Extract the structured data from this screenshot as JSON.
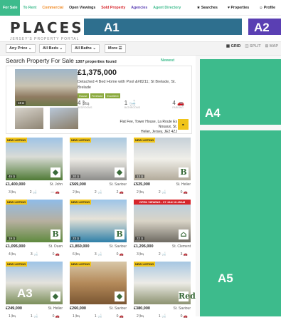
{
  "nav": {
    "items": [
      "For Sale",
      "To Rent",
      "Commercial",
      "Open Viewings",
      "Sold Property",
      "Agencies",
      "Agent Directory"
    ],
    "right": [
      "★ Searches",
      "♥ Properties",
      "☺ Profile"
    ]
  },
  "logo": {
    "title": "PLACES",
    "subtitle": "JERSEY'S PROPERTY PORTAL"
  },
  "ads": {
    "a1": "A1",
    "a2": "A2",
    "a3": "A3",
    "a4": "A4",
    "a5": "A5"
  },
  "filters": {
    "price": "Any Price ⌄",
    "beds": "All Beds ⌄",
    "baths": "All Baths ⌄",
    "more": "More ☰"
  },
  "views": {
    "grid": "▦ GRID",
    "split": "◫ SPLIT",
    "map": "⊞ MAP"
  },
  "heading": {
    "title": "Search Property For Sale",
    "count": "1307 properties found",
    "sort": "Newest"
  },
  "featured": {
    "price": "£1,375,000",
    "description": "Detached 4 Bed Home with Pool &#8211; St Brelade, St. Brelade",
    "tags": [
      "House",
      "Freehold",
      "Excellent"
    ],
    "beds": "4 🛏",
    "baths": "1 🛁",
    "parking": "4 🚗",
    "bed_label": "BEDROOMS",
    "bath_label": "BATHROOMS",
    "park_label": "PARKING",
    "img_count": "18 ◘",
    "agent_line1": "Flat Fee, Tower House, La Route Es Nouaux, St.",
    "agent_line2": "Helier, Jersey, JE2 4ZJ",
    "agent_logo": "■"
  },
  "cards": [
    {
      "price": "£1,400,000",
      "loc": "St. John",
      "beds": "3 🛏",
      "baths": "2 🛁",
      "park": "— 🚗",
      "badge": "NEW LISTING",
      "count": "45 ◘",
      "agent": "◆"
    },
    {
      "price": "£569,000",
      "loc": "St. Saviour",
      "beds": "2 🛏",
      "baths": "2 🛁",
      "park": "2 🚗",
      "badge": "NEW LISTING",
      "count": "20 ◘",
      "agent": "◆"
    },
    {
      "price": "£525,000",
      "loc": "St. Helier",
      "beds": "2 🛏",
      "baths": "2 🛁",
      "park": "0 🚗",
      "badge": "NEW LISTING",
      "count": "13 ◘",
      "agent": "B"
    },
    {
      "price": "£1,095,000",
      "loc": "St. Ouen",
      "beds": "4 🛏",
      "baths": "3 🛁",
      "park": "0 🚗",
      "badge": "NEW LISTING",
      "count": "19 ◘",
      "agent": "B"
    },
    {
      "price": "£1,850,000",
      "loc": "St. Saviour",
      "beds": "6 🛏",
      "baths": "3 🛁",
      "park": "0 🚗",
      "badge": "NEW LISTING",
      "count": "23 ◘",
      "agent": "B"
    },
    {
      "price": "£1,295,000",
      "loc": "St. Clement",
      "beds": "3 🛏",
      "baths": "2 🛁",
      "park": "3 🚗",
      "badge": "OPEN VIEWING - 07 JAN 10:45AM",
      "count": "22 ◘",
      "agent": "⌂"
    },
    {
      "price": "£249,000",
      "loc": "St. Helier",
      "beds": "1 🛏",
      "baths": "1 🛁",
      "park": "0 🚗",
      "badge": "NEW LISTING",
      "count": "",
      "agent": "◆"
    },
    {
      "price": "£260,000",
      "loc": "St. Saviour",
      "beds": "1 🛏",
      "baths": "1 🛁",
      "park": "0 🚗",
      "badge": "NEW LISTING",
      "count": "",
      "agent": "◆"
    },
    {
      "price": "£380,000",
      "loc": "St. Saviour",
      "beds": "2 🛏",
      "baths": "1 🛁",
      "park": "0 🚗",
      "badge": "NEW LISTING",
      "count": "",
      "agent": "Red"
    }
  ]
}
